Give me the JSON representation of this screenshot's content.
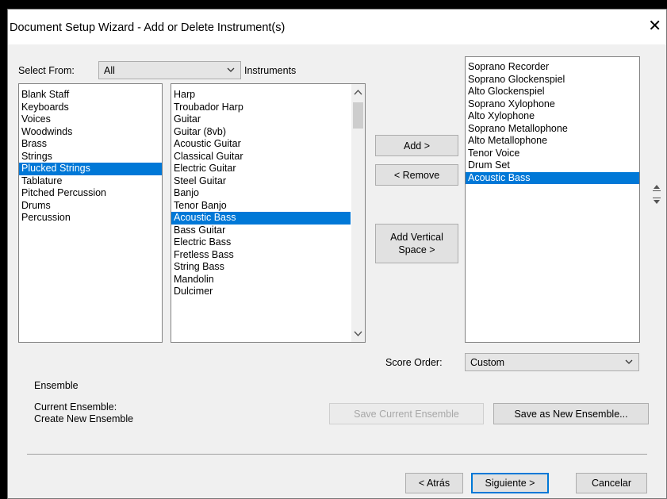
{
  "window": {
    "title": "Document Setup Wizard - Add or Delete Instrument(s)"
  },
  "select_from": {
    "label": "Select From:",
    "value": "All"
  },
  "instruments_label": "Instruments",
  "families": [
    {
      "label": "Blank Staff",
      "selected": false
    },
    {
      "label": "Keyboards",
      "selected": false
    },
    {
      "label": "Voices",
      "selected": false
    },
    {
      "label": "Woodwinds",
      "selected": false
    },
    {
      "label": "Brass",
      "selected": false
    },
    {
      "label": "Strings",
      "selected": false
    },
    {
      "label": "Plucked Strings",
      "selected": true
    },
    {
      "label": "Tablature",
      "selected": false
    },
    {
      "label": "Pitched Percussion",
      "selected": false
    },
    {
      "label": "Drums",
      "selected": false
    },
    {
      "label": "Percussion",
      "selected": false
    }
  ],
  "instruments": [
    {
      "label": "Harp",
      "selected": false
    },
    {
      "label": "Troubador Harp",
      "selected": false
    },
    {
      "label": "Guitar",
      "selected": false
    },
    {
      "label": "Guitar (8vb)",
      "selected": false
    },
    {
      "label": "Acoustic Guitar",
      "selected": false
    },
    {
      "label": "Classical Guitar",
      "selected": false
    },
    {
      "label": "Electric Guitar",
      "selected": false
    },
    {
      "label": "Steel Guitar",
      "selected": false
    },
    {
      "label": "Banjo",
      "selected": false
    },
    {
      "label": "Tenor Banjo",
      "selected": false
    },
    {
      "label": "Acoustic Bass",
      "selected": true
    },
    {
      "label": "Bass Guitar",
      "selected": false
    },
    {
      "label": "Electric Bass",
      "selected": false
    },
    {
      "label": "Fretless Bass",
      "selected": false
    },
    {
      "label": "String Bass",
      "selected": false
    },
    {
      "label": "Mandolin",
      "selected": false
    },
    {
      "label": "Dulcimer",
      "selected": false
    }
  ],
  "selected_instruments": [
    {
      "label": "Soprano Recorder",
      "selected": false
    },
    {
      "label": "Soprano Glockenspiel",
      "selected": false
    },
    {
      "label": "Alto Glockenspiel",
      "selected": false
    },
    {
      "label": "Soprano Xylophone",
      "selected": false
    },
    {
      "label": "Alto Xylophone",
      "selected": false
    },
    {
      "label": "Soprano Metallophone",
      "selected": false
    },
    {
      "label": "Alto Metallophone",
      "selected": false
    },
    {
      "label": "Tenor Voice",
      "selected": false
    },
    {
      "label": "Drum Set",
      "selected": false
    },
    {
      "label": "Acoustic Bass",
      "selected": true
    }
  ],
  "buttons": {
    "add": "Add >",
    "remove": "< Remove",
    "add_vertical_space": "Add Vertical\nSpace >",
    "save_current_ensemble": "Save Current Ensemble",
    "save_as_new_ensemble": "Save as New Ensemble...",
    "back": "< Atrás",
    "next": "Siguiente >",
    "cancel": "Cancelar"
  },
  "score_order": {
    "label": "Score Order:",
    "value": "Custom"
  },
  "ensemble": {
    "heading": "Ensemble",
    "current_label": "Current Ensemble:",
    "current_value": "Create New Ensemble"
  }
}
